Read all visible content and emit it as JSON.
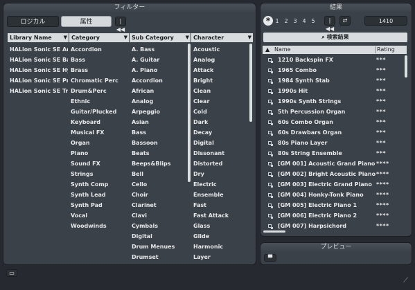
{
  "filter_panel": {
    "title": "フィルター",
    "tabs": [
      {
        "label": "ロジカル",
        "active": false
      },
      {
        "label": "属性",
        "active": true
      }
    ],
    "reset_icon": "skip-back-icon",
    "columns": [
      {
        "header": "Library Name",
        "items": [
          "HALion Sonic SE Artis",
          "HALion Sonic SE Basic",
          "HALion Sonic SE Hybr",
          "HALion Sonic SE Pro",
          "HALion Sonic SE Trip"
        ]
      },
      {
        "header": "Category",
        "items": [
          "Accordion",
          "Bass",
          "Brass",
          "Chromatic Perc",
          "Drum&Perc",
          "Ethnic",
          "Guitar/Plucked",
          "Keyboard",
          "Musical FX",
          "Organ",
          "Piano",
          "Sound FX",
          "Strings",
          "Synth Comp",
          "Synth Lead",
          "Synth Pad",
          "Vocal",
          "Woodwinds"
        ]
      },
      {
        "header": "Sub Category",
        "items": [
          "A. Bass",
          "A. Guitar",
          "A. Piano",
          "Accordion",
          "African",
          "Analog",
          "Arpeggio",
          "Asian",
          "Bass",
          "Bassoon",
          "Beats",
          "Beeps&Blips",
          "Bell",
          "Cello",
          "Choir",
          "Clarinet",
          "Clavi",
          "Cymbals",
          "Digital",
          "Drum Menues",
          "Drumset"
        ]
      },
      {
        "header": "Character",
        "items": [
          "Acoustic",
          "Analog",
          "Attack",
          "Bright",
          "Clean",
          "Clear",
          "Cold",
          "Dark",
          "Decay",
          "Digital",
          "Dissonant",
          "Distorted",
          "Dry",
          "Electric",
          "Ensemble",
          "Fast",
          "Fast Attack",
          "Glass",
          "Glide",
          "Harmonic",
          "Layer"
        ]
      }
    ]
  },
  "results_panel": {
    "title": "結果",
    "rating_filter_icon": "asterisk-icon",
    "rating_levels": [
      "1",
      "2",
      "3",
      "4",
      "5"
    ],
    "count": "1410",
    "search_label": "検索結果",
    "search_icon": "magnifier-icon",
    "col_name": "Name",
    "col_rating": "Rating",
    "rows": [
      {
        "name": "1210 Backspin FX",
        "rating": "***"
      },
      {
        "name": "1965 Combo",
        "rating": "***"
      },
      {
        "name": "1984 Synth Stab",
        "rating": "***"
      },
      {
        "name": "1990s Hit",
        "rating": "***"
      },
      {
        "name": "1990s Synth Strings",
        "rating": "***"
      },
      {
        "name": "5th Percussion Organ",
        "rating": "***"
      },
      {
        "name": "60s Combo Organ",
        "rating": "***"
      },
      {
        "name": "60s Drawbars Organ",
        "rating": "***"
      },
      {
        "name": "80s Piano Layer",
        "rating": "***"
      },
      {
        "name": "80s String Ensemble",
        "rating": "***"
      },
      {
        "name": "[GM 001] Acoustic Grand Piano",
        "rating": "****"
      },
      {
        "name": "[GM 002] Bright Acoustic Piano",
        "rating": "****"
      },
      {
        "name": "[GM 003] Electric Grand Piano",
        "rating": "****"
      },
      {
        "name": "[GM 004] Honky-Tonk Piano",
        "rating": "****"
      },
      {
        "name": "[GM 005] Electric Piano 1",
        "rating": "****"
      },
      {
        "name": "[GM 006] Electric Piano 2",
        "rating": "****"
      },
      {
        "name": "[GM 007] Harpsichord",
        "rating": "****"
      }
    ]
  },
  "preview_panel": {
    "title": "プレビュー"
  }
}
